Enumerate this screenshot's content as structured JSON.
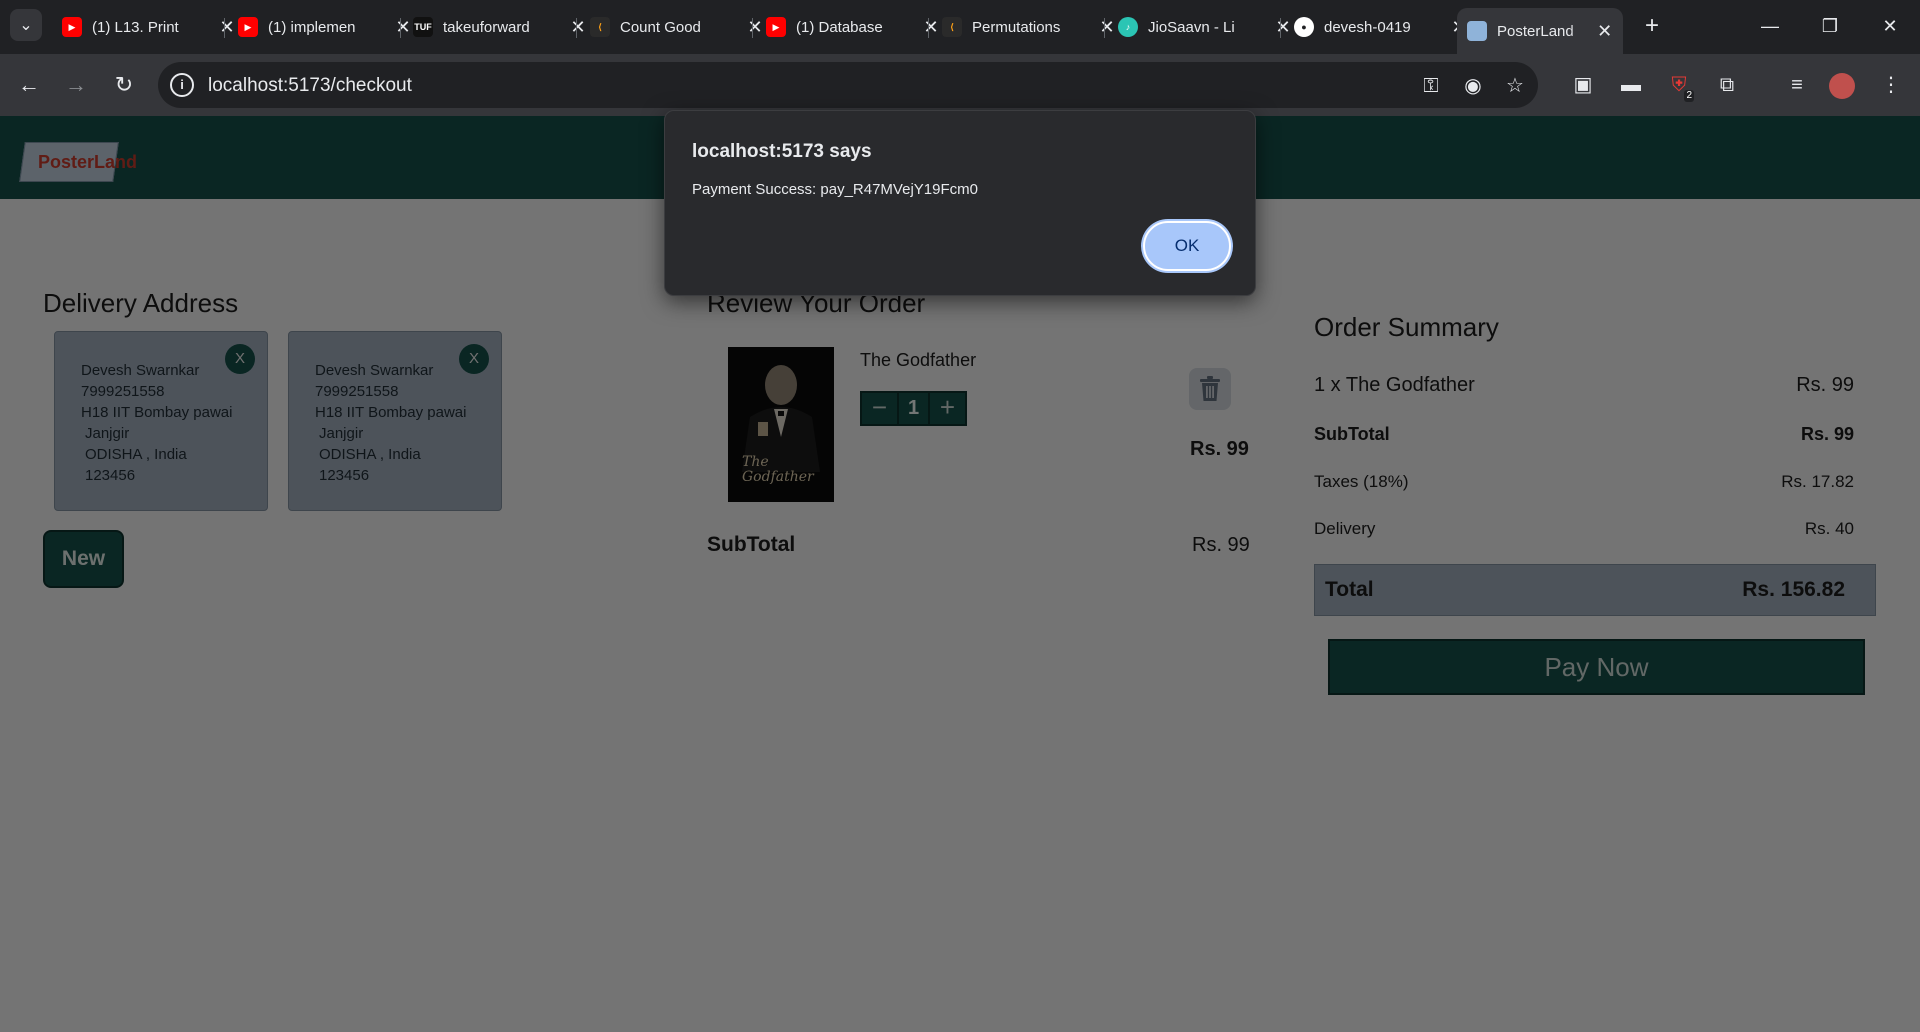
{
  "browser": {
    "tabs": [
      {
        "label": "(1) L13. Print",
        "icon": "youtube-icon",
        "color": "#ff0000"
      },
      {
        "label": "(1) implemen",
        "icon": "youtube-icon",
        "color": "#ff0000"
      },
      {
        "label": "takeuforward",
        "icon": "tuf-icon",
        "color": "#111111"
      },
      {
        "label": "Count Good",
        "icon": "leetcode-icon",
        "color": "#ffa116"
      },
      {
        "label": "(1) Database",
        "icon": "youtube-icon",
        "color": "#ff0000"
      },
      {
        "label": "Permutations",
        "icon": "leetcode-icon",
        "color": "#ffa116"
      },
      {
        "label": "JioSaavn - Li",
        "icon": "jiosaavn-icon",
        "color": "#2bc5b4"
      },
      {
        "label": "devesh-0419",
        "icon": "github-icon",
        "color": "#ffffff"
      },
      {
        "label": "PosterLand",
        "icon": "posterland-icon",
        "color": "#8fb3d9"
      }
    ],
    "url": "localhost:5173/checkout",
    "ext_badge": "2"
  },
  "site": {
    "logo_text": "PosterLand",
    "colors": {
      "primary": "#144d47",
      "card": "#9aa7b5"
    }
  },
  "delivery": {
    "title": "Delivery Address",
    "addresses": [
      {
        "name": "Devesh Swarnkar",
        "phone": "7999251558",
        "line1": "H18 IIT Bombay pawai",
        "city": "Janjgir",
        "state_country": "ODISHA , India",
        "pin": "123456",
        "remove": "X"
      },
      {
        "name": "Devesh Swarnkar",
        "phone": "7999251558",
        "line1": "H18 IIT Bombay pawai",
        "city": "Janjgir",
        "state_country": "ODISHA , India",
        "pin": "123456",
        "remove": "X"
      }
    ],
    "new_label": "New"
  },
  "review": {
    "title": "Review Your Order",
    "item": {
      "name": "The Godfather",
      "qty": "1",
      "price": "Rs. 99",
      "poster_text": "The Godfather"
    },
    "subtotal_label": "SubTotal",
    "subtotal_value": "Rs. 99"
  },
  "summary": {
    "title": "Order Summary",
    "line_item": {
      "label": "1 x The Godfather",
      "value": "Rs. 99"
    },
    "subtotal": {
      "label": "SubTotal",
      "value": "Rs. 99"
    },
    "taxes": {
      "label": "Taxes (18%)",
      "value": "Rs. 17.82"
    },
    "delivery": {
      "label": "Delivery",
      "value": "Rs. 40"
    },
    "total": {
      "label": "Total",
      "value": "Rs. 156.82"
    },
    "pay_label": "Pay Now"
  },
  "dialog": {
    "title": "localhost:5173 says",
    "message": "Payment Success: pay_R47MVejY19Fcm0",
    "ok_label": "OK"
  }
}
